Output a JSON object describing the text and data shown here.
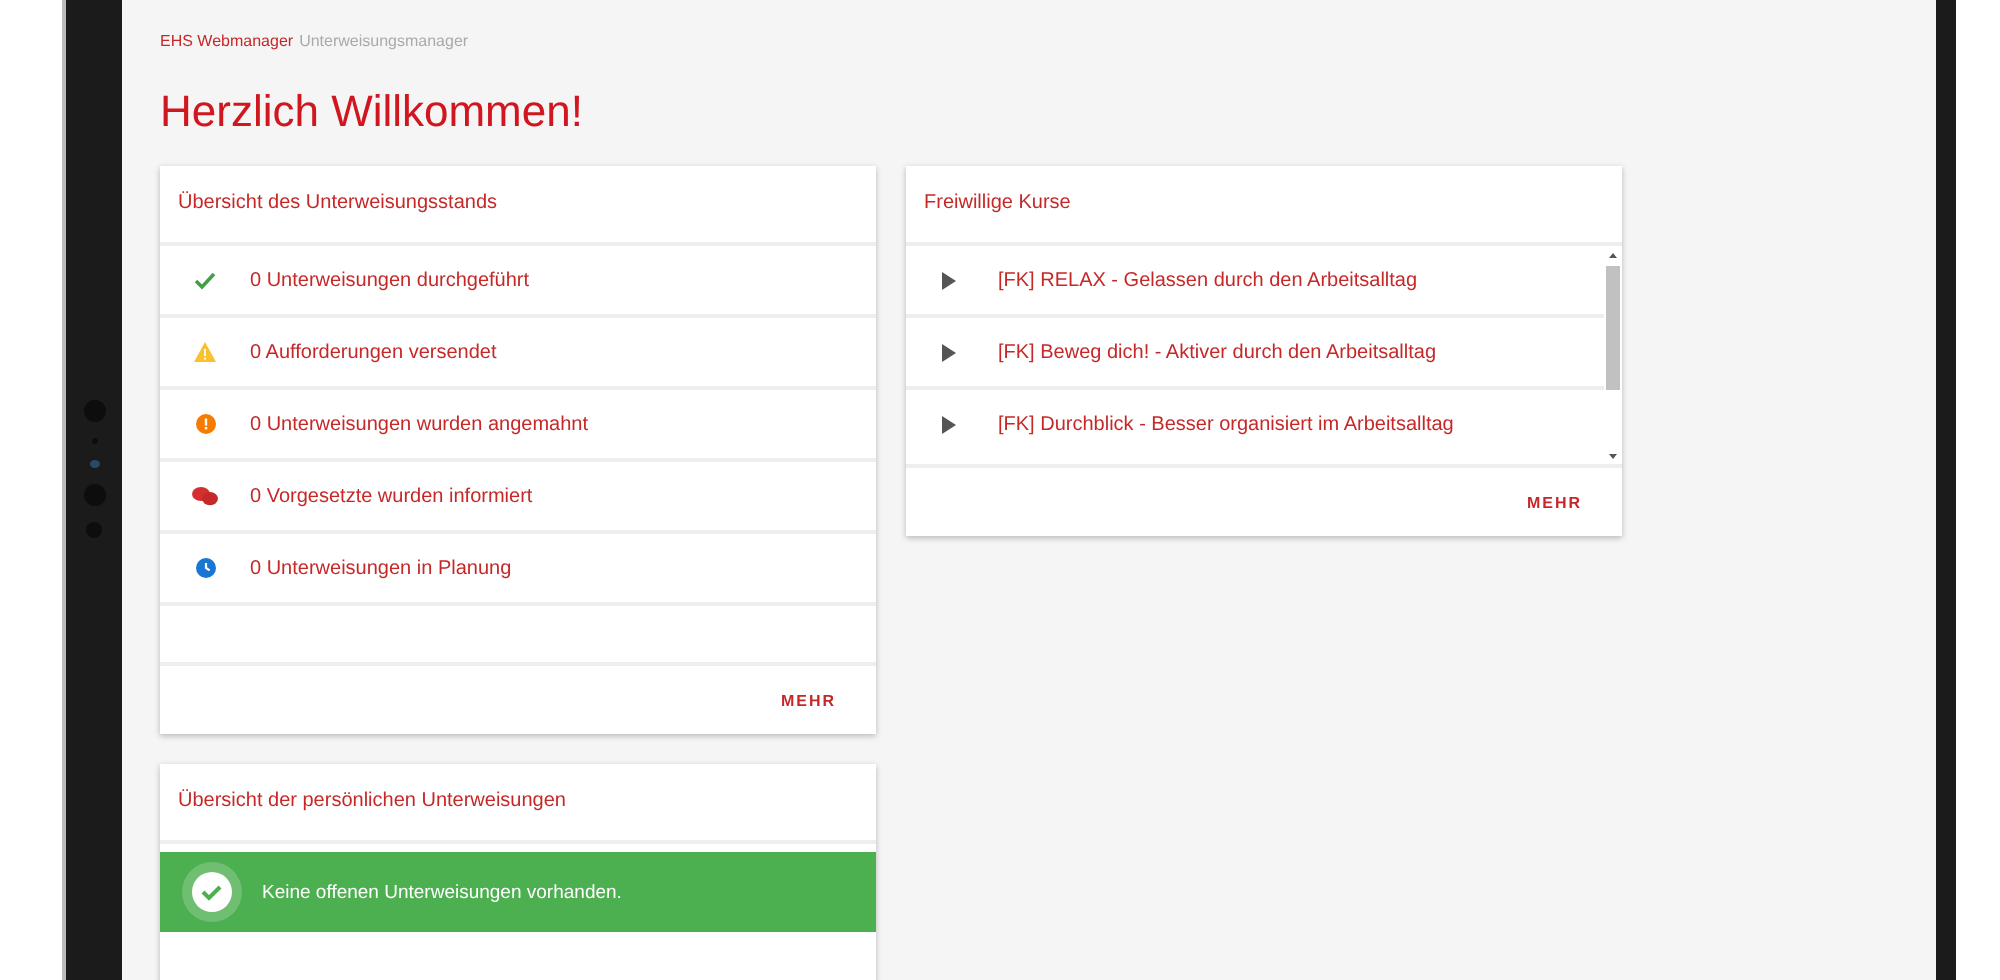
{
  "breadcrumb": {
    "app": "EHS Webmanager",
    "module": "Unterweisungsmanager"
  },
  "title": "Herzlich Willkommen!",
  "status_card": {
    "title": "Übersicht des Unterweisungsstands",
    "items": [
      {
        "kind": "done",
        "text": "0 Unterweisungen durchgeführt"
      },
      {
        "kind": "warning",
        "text": "0 Aufforderungen versendet"
      },
      {
        "kind": "reminder",
        "text": "0 Unterweisungen wurden angemahnt"
      },
      {
        "kind": "supervisor",
        "text": "0 Vorgesetzte wurden informiert"
      },
      {
        "kind": "planned",
        "text": "0 Unterweisungen in Planung"
      }
    ],
    "more": "MEHR"
  },
  "courses_card": {
    "title": "Freiwillige Kurse",
    "items": [
      {
        "text": "[FK] RELAX - Gelassen durch den Arbeitsalltag"
      },
      {
        "text": "[FK] Beweg dich! - Aktiver durch den Arbeitsalltag"
      },
      {
        "text": "[FK] Durchblick - Besser organisiert im Arbeitsalltag"
      }
    ],
    "more": "MEHR"
  },
  "personal_card": {
    "title": "Übersicht der persönlichen Unterweisungen",
    "message": "Keine offenen Unterweisungen vorhanden."
  }
}
